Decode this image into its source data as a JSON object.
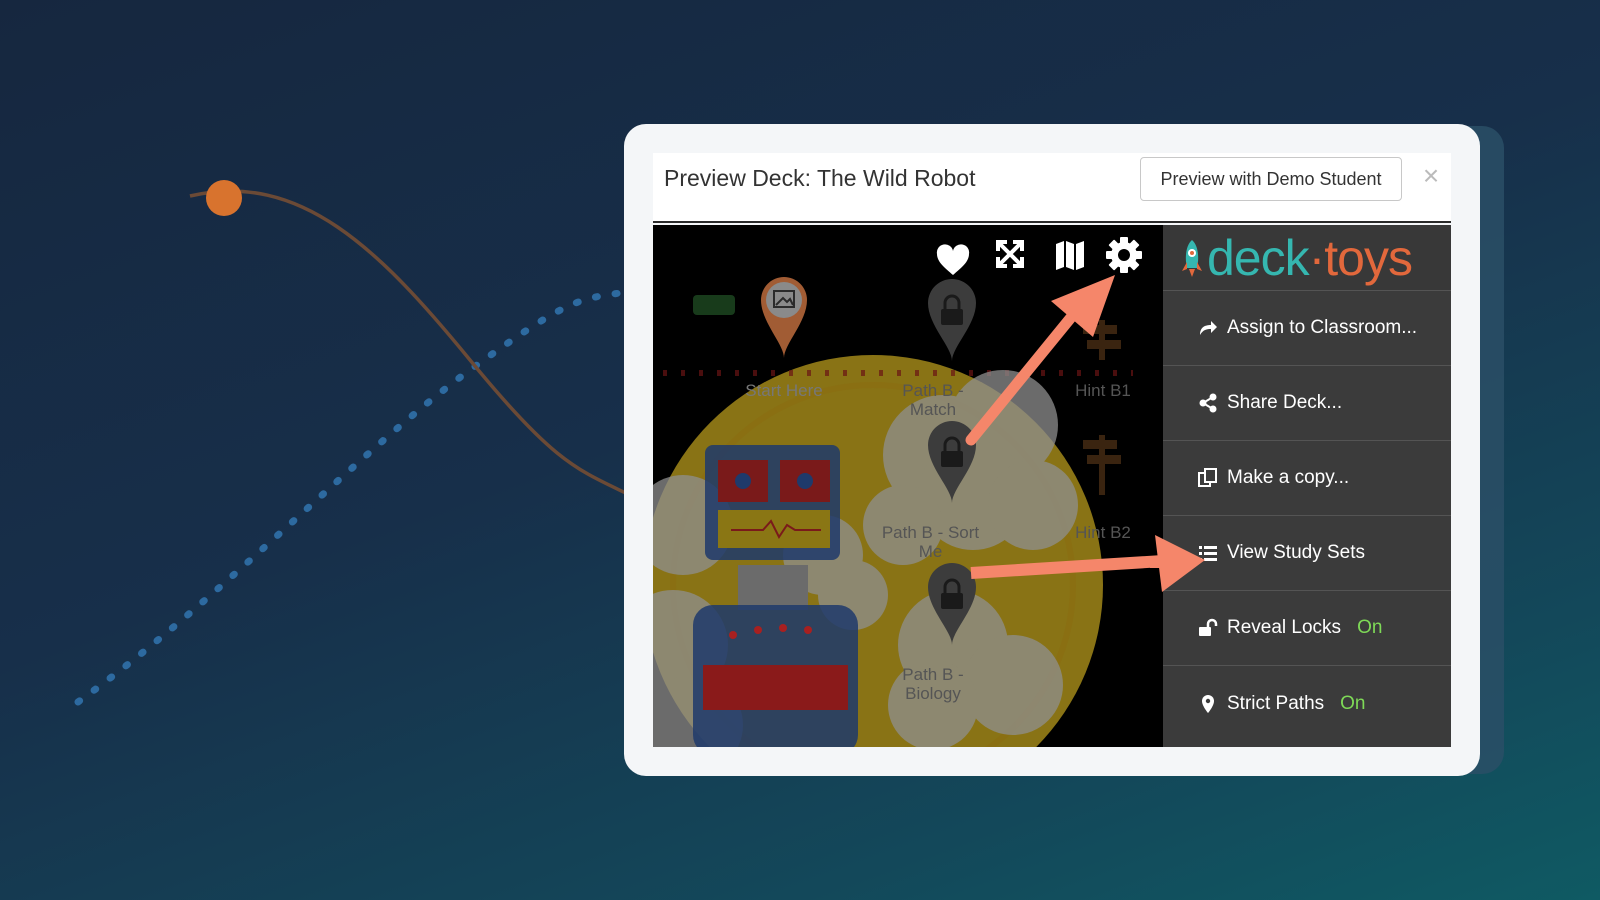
{
  "modal": {
    "title": "Preview Deck: The Wild Robot",
    "demo_button": "Preview with Demo Student",
    "close": "×"
  },
  "toolbar": {
    "icons": [
      "heart-icon",
      "fullscreen-icon",
      "map-icon",
      "gear-icon"
    ]
  },
  "map": {
    "labels": {
      "start_here": "Start Here",
      "path_b_match": "Path B - Match",
      "hint_b1": "Hint B1",
      "path_b_sort": "Path B - Sort Me",
      "hint_b2": "Hint B2",
      "path_b_biology": "Path B - Biology"
    }
  },
  "logo": {
    "left": "deck",
    "dot": "·",
    "right": "toys"
  },
  "menu": {
    "assign": "Assign to Classroom...",
    "share": "Share Deck...",
    "copy": "Make a copy...",
    "study_sets": "View Study Sets",
    "reveal_locks": "Reveal Locks",
    "reveal_locks_value": "On",
    "strict_paths": "Strict Paths",
    "strict_paths_value": "On"
  },
  "colors": {
    "accent_arrow": "#f5866a",
    "on_green": "#7ed957",
    "logo_teal": "#35b7b0",
    "logo_orange": "#e2683c"
  }
}
